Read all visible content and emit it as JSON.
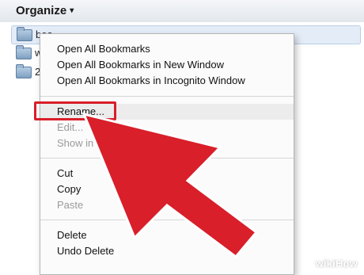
{
  "toolbar": {
    "organize_label": "Organize",
    "caret": "▾"
  },
  "tree": {
    "items": [
      {
        "label": "bea",
        "selected": true
      },
      {
        "label": "w",
        "selected": false
      },
      {
        "label": "2",
        "selected": false
      }
    ]
  },
  "context_menu": {
    "items": [
      {
        "label": "Open All Bookmarks",
        "enabled": true
      },
      {
        "label": "Open All Bookmarks in New Window",
        "enabled": true
      },
      {
        "label": "Open All Bookmarks in Incognito Window",
        "enabled": true
      },
      {
        "label": "Rename...",
        "enabled": true,
        "highlighted": true
      },
      {
        "label": "Edit...",
        "enabled": false
      },
      {
        "label": "Show in",
        "enabled": false
      },
      {
        "label": "Cut",
        "enabled": true
      },
      {
        "label": "Copy",
        "enabled": true
      },
      {
        "label": "Paste",
        "enabled": false
      },
      {
        "label": "Delete",
        "enabled": true
      },
      {
        "label": "Undo Delete",
        "enabled": true
      }
    ]
  },
  "watermark": {
    "text": "wikiHow"
  },
  "colors": {
    "annotation_red": "#d81f2a",
    "menu_bg": "#fbfbfb",
    "selection_bg": "#e4ecf7"
  }
}
